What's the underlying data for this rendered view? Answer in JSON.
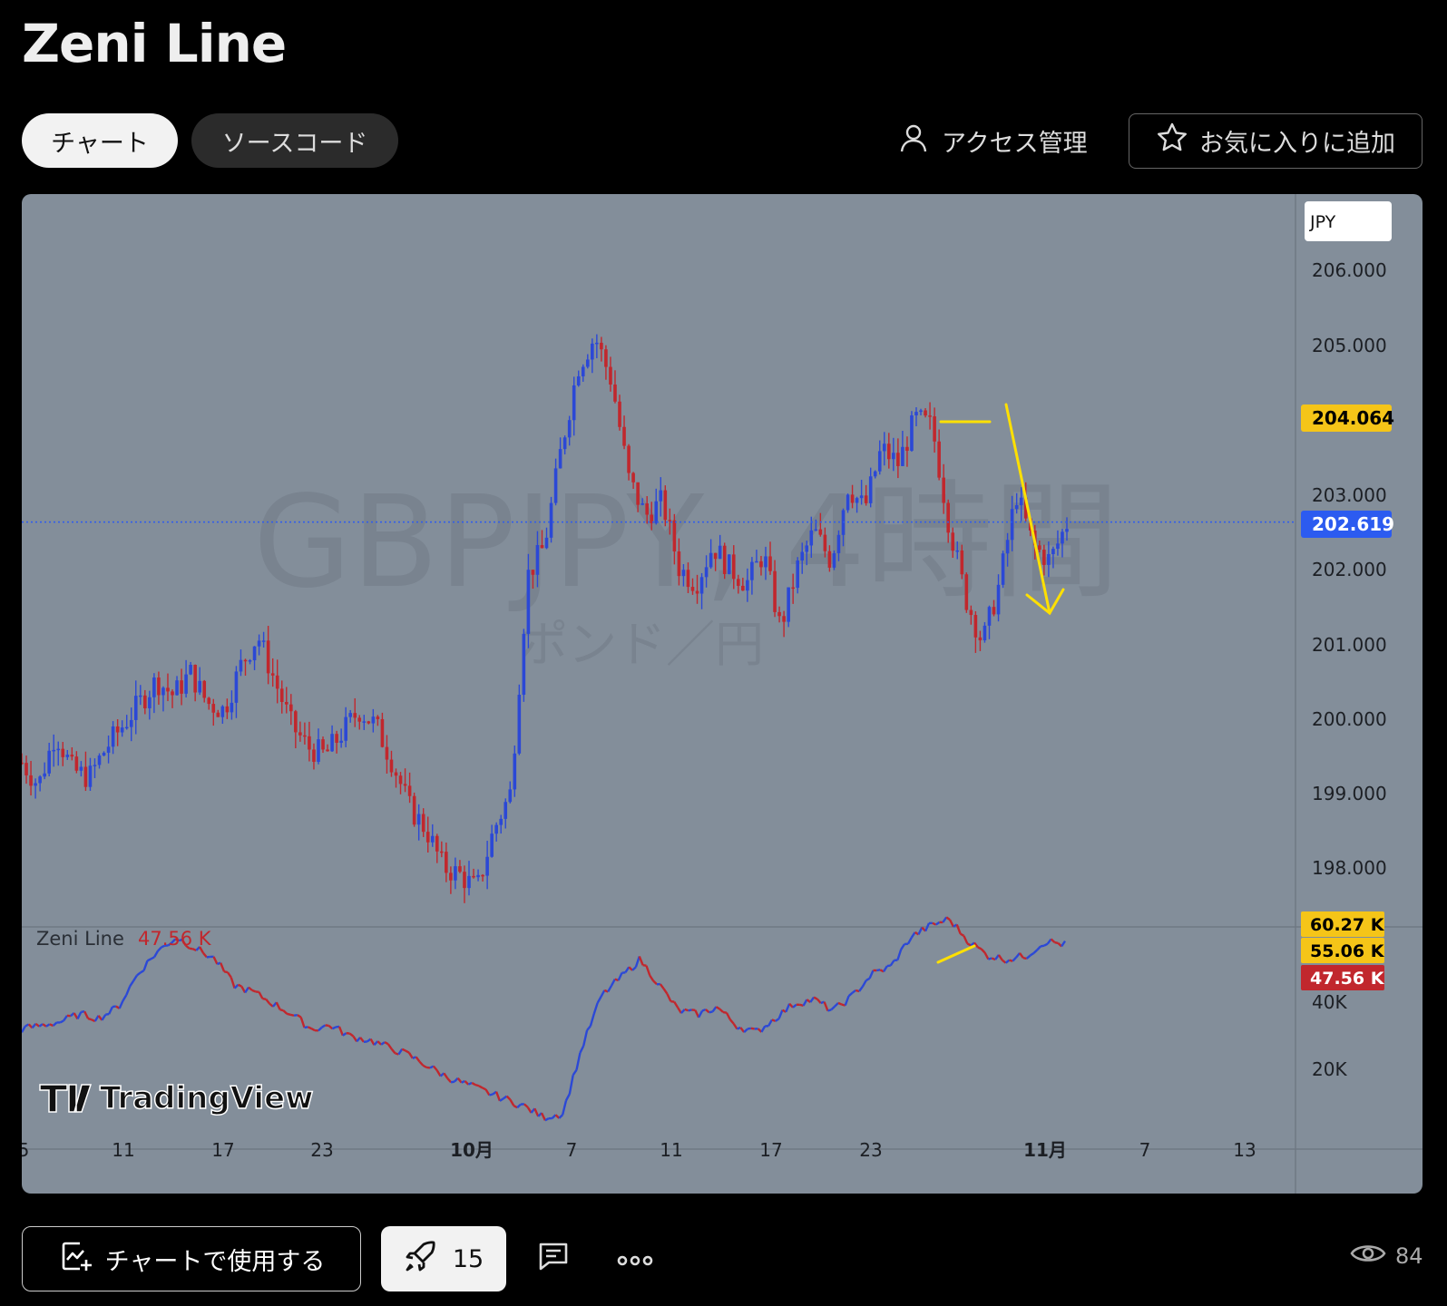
{
  "header": {
    "title": "Zeni Line"
  },
  "tabs": [
    {
      "label": "チャート"
    },
    {
      "label": "ソースコード"
    }
  ],
  "actions": {
    "access_label": "アクセス管理",
    "favorite_label": "お気に入りに追加"
  },
  "chart": {
    "watermark_symbol": "GBPJPY, 4時間",
    "watermark_name": "ポンド／円",
    "currency": "JPY",
    "price_axis": [
      "206.000",
      "205.000",
      "203.000",
      "202.000",
      "201.000",
      "200.000",
      "199.000",
      "198.000"
    ],
    "price_tags": [
      {
        "text": "204.064",
        "color": "#f5c518",
        "text_color": "#000"
      },
      {
        "text": "202.619",
        "color": "#2c5bf0",
        "text_color": "#fff"
      }
    ],
    "indicator_name": "Zeni Line",
    "indicator_value": "47.56 K",
    "indicator_axis": [
      "40K",
      "20K"
    ],
    "indicator_tags": [
      {
        "text": "60.27 K",
        "color": "#f5c518",
        "text_color": "#000"
      },
      {
        "text": "55.06 K",
        "color": "#f5c518",
        "text_color": "#000"
      },
      {
        "text": "47.56 K",
        "color": "#c1272d",
        "text_color": "#fff"
      }
    ],
    "time_axis": [
      "5",
      "11",
      "17",
      "23",
      "10月",
      "7",
      "11",
      "17",
      "23",
      "11月",
      "7",
      "13"
    ],
    "brand": "TradingView",
    "colors": {
      "up": "#2b48d6",
      "down": "#c1272d",
      "annotation": "#ffe000",
      "background": "#838e9a"
    }
  },
  "chart_data": {
    "type": "candlestick",
    "symbol": "GBPJPY",
    "interval": "4時間",
    "ylim": [
      197.5,
      206.5
    ],
    "last_price": 202.619,
    "price_path": [
      199.4,
      199.1,
      199.8,
      199.3,
      199.2,
      199.6,
      199.9,
      200.2,
      200.5,
      200.3,
      200.6,
      200.2,
      200.1,
      200.7,
      201.1,
      200.5,
      199.9,
      199.6,
      199.5,
      199.8,
      200.1,
      199.9,
      199.4,
      198.8,
      198.5,
      198.0,
      197.9,
      197.7,
      198.5,
      199.0,
      201.9,
      202.3,
      203.6,
      204.7,
      205.1,
      204.5,
      203.2,
      202.7,
      202.9,
      202.0,
      201.8,
      202.3,
      202.0,
      201.8,
      202.2,
      201.2,
      202.0,
      202.5,
      202.1,
      203.1,
      202.8,
      203.6,
      203.4,
      204.0,
      203.9,
      202.6,
      201.6,
      201.0,
      201.8,
      203.0,
      202.3,
      202.1,
      202.6
    ],
    "indicator": {
      "name": "Zeni Line",
      "last_value": 47.56,
      "unit": "K",
      "values": [
        27,
        28,
        29,
        31,
        30,
        33,
        42,
        48,
        52,
        49,
        46,
        39,
        37,
        34,
        31,
        27,
        28,
        25,
        24,
        22,
        20,
        17,
        14,
        12,
        10,
        8,
        6,
        3,
        4,
        22,
        36,
        41,
        46,
        39,
        32,
        31,
        33,
        28,
        26,
        30,
        34,
        35,
        32,
        36,
        42,
        44,
        52,
        55,
        57,
        51,
        47,
        46,
        47,
        51,
        50
      ]
    }
  }
}
